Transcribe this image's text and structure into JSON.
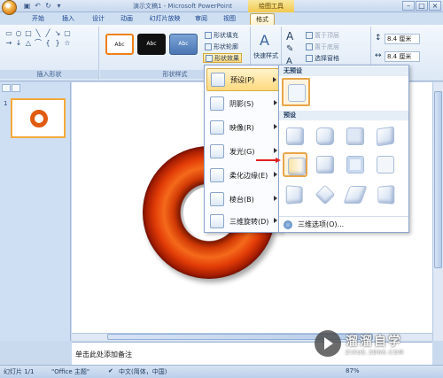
{
  "window": {
    "title": "演示文稿1 - Microsoft PowerPoint",
    "contextual_tab_title": "绘图工具",
    "controls": [
      "–",
      "□",
      "×"
    ]
  },
  "tabs": [
    {
      "label": "开始"
    },
    {
      "label": "插入"
    },
    {
      "label": "设计"
    },
    {
      "label": "动画"
    },
    {
      "label": "幻灯片放映"
    },
    {
      "label": "审阅"
    },
    {
      "label": "视图"
    },
    {
      "label": "格式"
    }
  ],
  "ribbon": {
    "insert_shapes_label": "插入形状",
    "shape_styles_label": "形状样式",
    "style_preview_text": "Abc",
    "fill_label": "形状填充",
    "outline_label": "形状轮廓",
    "effects_label": "形状效果",
    "quick_styles_label": "快速样式",
    "bring_forward_label": "置于顶层",
    "send_backward_label": "置于底层",
    "selection_pane_label": "选择窗格",
    "height_value": "8.4 厘米",
    "width_value": "8.4 厘米"
  },
  "slide_panel": {
    "slide_number": "1"
  },
  "effects_menu": {
    "items": [
      {
        "label": "预设(P)"
      },
      {
        "label": "阴影(S)"
      },
      {
        "label": "映像(R)"
      },
      {
        "label": "发光(G)"
      },
      {
        "label": "柔化边缘(E)"
      },
      {
        "label": "棱台(B)"
      },
      {
        "label": "三维旋转(D)"
      }
    ]
  },
  "preset_panel": {
    "none_header": "无预设",
    "preset_header": "预设",
    "footer_option": "三维选项(O)..."
  },
  "notes": {
    "placeholder": "单击此处添加备注"
  },
  "status": {
    "slide_info": "幻灯片 1/1",
    "theme": "\"Office 主题\"",
    "language": "中文(简体，中国)",
    "zoom": "87%"
  },
  "watermark": {
    "title": "溜溜自学",
    "subtitle": "ZIXUE.3D66.COM"
  }
}
